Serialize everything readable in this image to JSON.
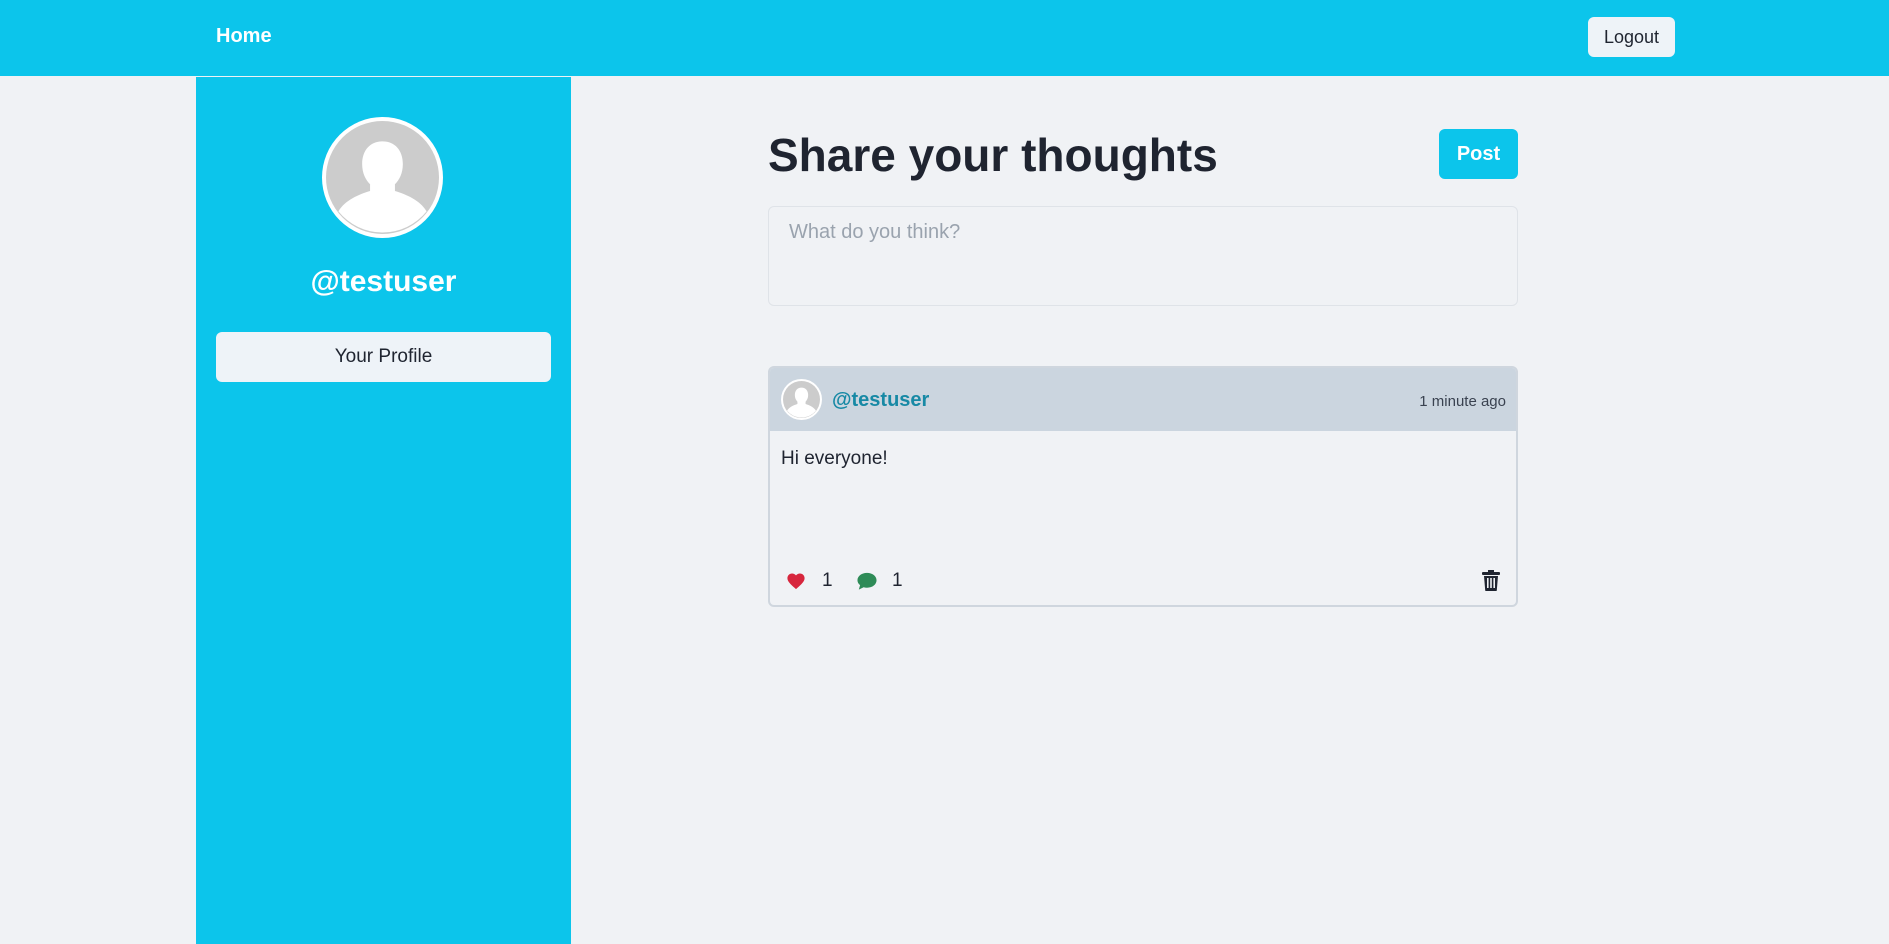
{
  "navbar": {
    "home_label": "Home",
    "logout_label": "Logout"
  },
  "sidebar": {
    "username": "@testuser",
    "profile_button_label": "Your Profile"
  },
  "composer": {
    "title": "Share your thoughts",
    "post_button_label": "Post",
    "placeholder": "What do you think?",
    "value": ""
  },
  "posts": [
    {
      "author": "@testuser",
      "time": "1 minute ago",
      "body": "Hi everyone!",
      "likes": "1",
      "comments": "1",
      "icons": [
        "heart-icon",
        "comment-icon",
        "trash-icon"
      ]
    }
  ],
  "colors": {
    "accent": "#0cc5eb",
    "background": "#f0f2f5",
    "post_header": "#cbd5df",
    "author_link": "#1789a5",
    "like": "#d7263d",
    "comment": "#2e8b57"
  }
}
